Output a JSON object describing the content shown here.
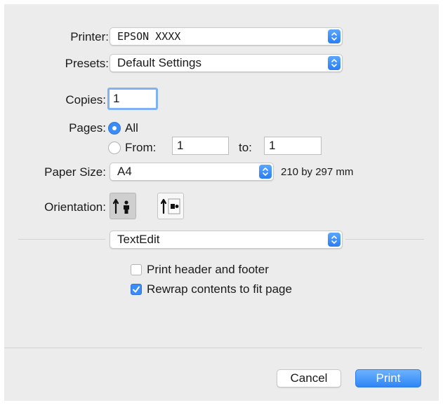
{
  "printer": {
    "label": "Printer:",
    "value": "EPSON XXXX"
  },
  "presets": {
    "label": "Presets:",
    "value": "Default Settings"
  },
  "copies": {
    "label": "Copies:",
    "value": "1"
  },
  "pages": {
    "label": "Pages:",
    "all_label": "All",
    "from_label": "From:",
    "from_value": "1",
    "to_label": "to:",
    "to_value": "1",
    "selected": "all"
  },
  "paper_size": {
    "label": "Paper Size:",
    "value": "A4",
    "dimensions": "210 by 297 mm"
  },
  "orientation": {
    "label": "Orientation:",
    "selected": "portrait"
  },
  "section_menu": {
    "value": "TextEdit"
  },
  "options": [
    {
      "label": "Print header and footer",
      "checked": false
    },
    {
      "label": "Rewrap contents to fit page",
      "checked": true
    }
  ],
  "buttons": {
    "cancel": "Cancel",
    "print": "Print"
  },
  "colors": {
    "accent": "#3b8cf6",
    "panel": "#ececec"
  }
}
